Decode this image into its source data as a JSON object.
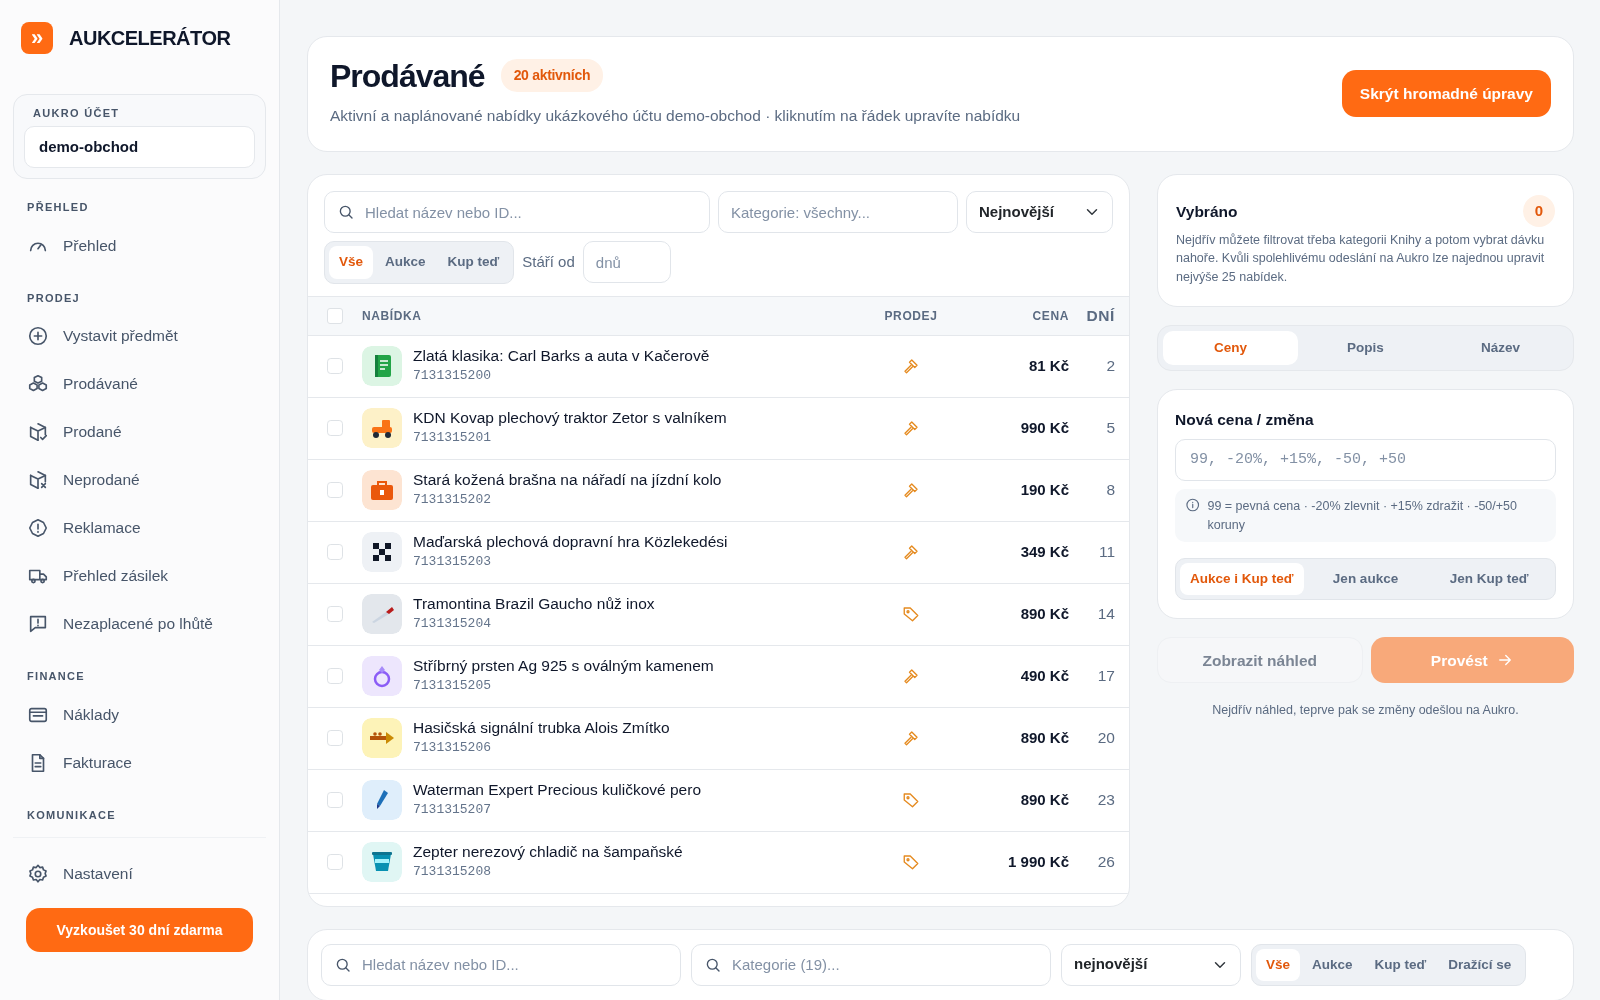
{
  "brand": {
    "logo_glyph": "»",
    "name": "AUKCELERÁTOR"
  },
  "account": {
    "label": "AUKRO ÚČET",
    "value": "demo-obchod"
  },
  "sidebar": {
    "sections": [
      {
        "title": "PŘEHLED",
        "items": [
          {
            "label": "Přehled"
          }
        ]
      },
      {
        "title": "PRODEJ",
        "items": [
          {
            "label": "Vystavit předmět"
          },
          {
            "label": "Prodávané"
          },
          {
            "label": "Prodané"
          },
          {
            "label": "Neprodané"
          },
          {
            "label": "Reklamace"
          },
          {
            "label": "Přehled zásilek"
          },
          {
            "label": "Nezaplacené po lhůtě"
          }
        ]
      },
      {
        "title": "FINANCE",
        "items": [
          {
            "label": "Náklady"
          },
          {
            "label": "Fakturace"
          }
        ]
      },
      {
        "title": "KOMUNIKACE"
      }
    ],
    "footer_items": [
      {
        "label": "Nastavení"
      }
    ],
    "trial_button": "Vyzkoušet 30 dní zdarma"
  },
  "header": {
    "title": "Prodávané",
    "badge": "20 aktivních",
    "subtitle": "Aktivní a naplánované nabídky ukázkového účtu demo-obchod · kliknutím na řádek upravíte nabídku",
    "action": "Skrýt hromadné úpravy"
  },
  "filters": {
    "search_placeholder": "Hledat název nebo ID...",
    "category_placeholder": "Kategorie: všechny...",
    "sort": "Nejnovější",
    "types": [
      {
        "label": "Vše",
        "selected": true
      },
      {
        "label": "Aukce",
        "selected": false
      },
      {
        "label": "Kup teď",
        "selected": false
      }
    ],
    "age_label": "Stáří od",
    "age_placeholder": "dnů"
  },
  "table": {
    "columns": [
      "NABÍDKA",
      "PRODEJ",
      "CENA",
      "DNÍ"
    ],
    "all_checked": false,
    "rows": [
      {
        "title": "Zlatá klasika: Carl Barks a auta v Kačerově",
        "id": "7131315200",
        "kind": "auction",
        "price": "81 Kč",
        "days": "2",
        "checked": false
      },
      {
        "title": "KDN Kovap plechový traktor Zetor s valníkem",
        "id": "7131315201",
        "kind": "auction",
        "price": "990 Kč",
        "days": "5",
        "checked": false
      },
      {
        "title": "Stará kožená brašna na nářadí na jízdní kolo",
        "id": "7131315202",
        "kind": "auction",
        "price": "190 Kč",
        "days": "8",
        "checked": false
      },
      {
        "title": "Maďarská plechová dopravní hra Közlekedési",
        "id": "7131315203",
        "kind": "auction",
        "price": "349 Kč",
        "days": "11",
        "checked": false
      },
      {
        "title": "Tramontina Brazil Gaucho nůž inox",
        "id": "7131315204",
        "kind": "buy_now",
        "price": "890 Kč",
        "days": "14",
        "checked": false
      },
      {
        "title": "Stříbrný prsten Ag 925 s oválným kamenem",
        "id": "7131315205",
        "kind": "auction",
        "price": "490 Kč",
        "days": "17",
        "checked": false
      },
      {
        "title": "Hasičská signální trubka Alois Zmítko",
        "id": "7131315206",
        "kind": "auction",
        "price": "890 Kč",
        "days": "20",
        "checked": false
      },
      {
        "title": "Waterman Expert Precious kuličkové pero",
        "id": "7131315207",
        "kind": "buy_now",
        "price": "890 Kč",
        "days": "23",
        "checked": false
      },
      {
        "title": "Zepter nerezový chladič na šampaňské",
        "id": "7131315208",
        "kind": "buy_now",
        "price": "1 990 Kč",
        "days": "26",
        "checked": false
      }
    ]
  },
  "bulk": {
    "selected_title": "Vybráno",
    "selected_count": "0",
    "selected_help": "Nejdřív můžete filtrovat třeba kategorii Knihy a potom vybrat dávku nahoře. Kvůli spolehlivému odeslání na Aukro lze najednou upravit nejvýše 25 nabídek.",
    "tabs": [
      {
        "label": "Ceny",
        "selected": true
      },
      {
        "label": "Popis",
        "selected": false
      },
      {
        "label": "Název",
        "selected": false
      }
    ],
    "price_label": "Nová cena / změna",
    "price_placeholder": "99, -20%, +15%, -50, +50",
    "hint": "99 = pevná cena · -20% zlevnit · +15% zdražit · -50/+50 koruny",
    "scope": [
      {
        "label": "Aukce i Kup teď",
        "selected": true
      },
      {
        "label": "Jen aukce",
        "selected": false
      },
      {
        "label": "Jen Kup teď",
        "selected": false
      }
    ],
    "preview_button": "Zobrazit náhled",
    "apply_button": {
      "label": "Provést",
      "disabled": true
    },
    "note": "Nejdřív náhled, teprve pak se změny odešlou na Aukro."
  },
  "bottom_filters": {
    "search_placeholder": "Hledat název nebo ID...",
    "category_placeholder": "Kategorie (19)...",
    "sort": "nejnovější",
    "types": [
      {
        "label": "Vše",
        "selected": true
      },
      {
        "label": "Aukce",
        "selected": false
      },
      {
        "label": "Kup teď",
        "selected": false
      },
      {
        "label": "Dražící se",
        "selected": false
      }
    ]
  }
}
